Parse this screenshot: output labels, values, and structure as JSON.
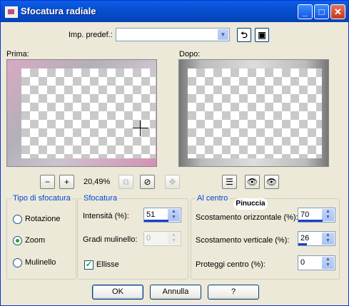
{
  "window": {
    "title": "Sfocatura radiale"
  },
  "presets": {
    "label": "Imp. predef.:",
    "value": ""
  },
  "preview": {
    "before_label": "Prima:",
    "after_label": "Dopo:",
    "zoom_level": "20,49%"
  },
  "blur_type": {
    "legend": "Tipo di sfocatura",
    "options": [
      {
        "label": "Rotazione",
        "selected": false
      },
      {
        "label": "Zoom",
        "selected": true
      },
      {
        "label": "Mulinello",
        "selected": false
      }
    ]
  },
  "blur": {
    "legend": "Sfocatura",
    "intensity_label": "Intensità (%):",
    "intensity_value": "51",
    "twirl_label": "Gradi mulinello:",
    "twirl_value": "0",
    "ellipse_label": "Ellisse",
    "ellipse_checked": true
  },
  "center": {
    "legend": "Al centro",
    "h_offset_label": "Scostamento orizzontale (%):",
    "h_offset_value": "70",
    "v_offset_label": "Scostamento verticale (%):",
    "v_offset_value": "26",
    "protect_label": "Proteggi centro (%):",
    "protect_value": "0"
  },
  "watermark": {
    "text": "Pinuccia"
  },
  "buttons": {
    "ok": "OK",
    "cancel": "Annulla",
    "help": "?"
  }
}
